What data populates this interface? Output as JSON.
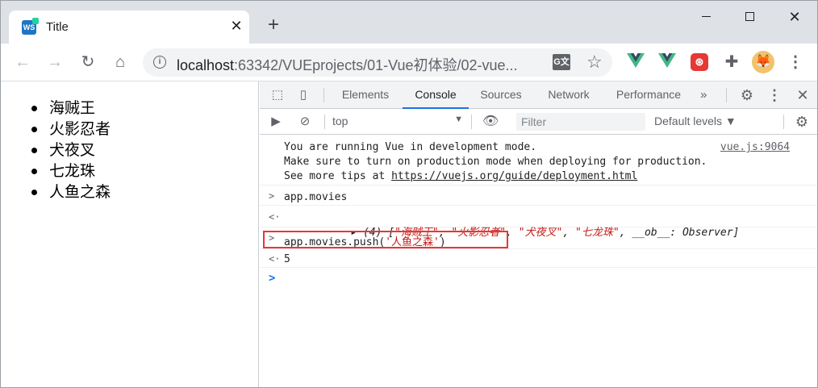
{
  "browser": {
    "tab_title": "Title",
    "favicon_text": "WS",
    "new_tab_symbol": "+",
    "url_host": "localhost",
    "url_path": ":63342/VUEprojects/01-Vue初体验/02-vue...",
    "window_controls": {
      "close_symbol": "✕"
    }
  },
  "page": {
    "movies": [
      "海贼王",
      "火影忍者",
      "犬夜叉",
      "七龙珠",
      "人鱼之森"
    ]
  },
  "devtools": {
    "tabs": [
      "Elements",
      "Console",
      "Sources",
      "Network",
      "Performance"
    ],
    "active_tab": "Console",
    "more_symbol": "»",
    "context": "top",
    "filter_placeholder": "Filter",
    "levels_label": "Default levels ▼"
  },
  "console": {
    "warning": {
      "line1": "You are running Vue in development mode.",
      "line2": "Make sure to turn on production mode when deploying for production.",
      "line3_prefix": "See more tips at ",
      "line3_link": "https://vuejs.org/guide/deployment.html",
      "source": "vue.js:9064"
    },
    "input1": "app.movies",
    "output1_count": "(4) [",
    "output1_items": [
      "\"海贼王\"",
      "\"火影忍者\"",
      "\"犬夜叉\"",
      "\"七龙珠\""
    ],
    "output1_tail": ", __ob__: Observer]",
    "input2_prefix": "app.movies.push(",
    "input2_arg": "'人鱼之森'",
    "input2_suffix": ")",
    "output2": "5"
  },
  "colors": {
    "highlight": "#e53935",
    "active_tab_underline": "#1a73e8",
    "string": "#c41a16",
    "number": "#1a1aa6"
  },
  "icons": {
    "vue_extension": "vue-icon",
    "puzzle_extension": "puzzle-icon"
  }
}
